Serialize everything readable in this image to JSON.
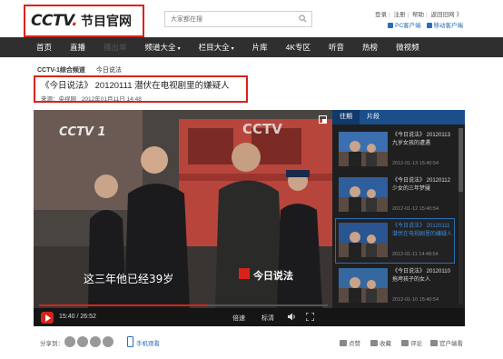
{
  "header": {
    "logo_cctv": "CCTV",
    "logo_dot": ".",
    "logo_sub": "节目官网",
    "search_placeholder": "大家都在搜",
    "top_links": [
      "登录",
      "注册",
      "帮助",
      "返回旧网"
    ],
    "top_links_arrow": "》",
    "app_links": [
      "PC客户端",
      "移动客户端"
    ]
  },
  "nav": {
    "items": [
      {
        "label": "首页",
        "dropdown": false,
        "dim": false
      },
      {
        "label": "直播",
        "dropdown": false,
        "dim": false
      },
      {
        "label": "播出单",
        "dropdown": false,
        "dim": true
      },
      {
        "label": "频道大全",
        "dropdown": true,
        "dim": false
      },
      {
        "label": "栏目大全",
        "dropdown": true,
        "dim": false
      },
      {
        "label": "片库",
        "dropdown": false,
        "dim": false
      },
      {
        "label": "4K专区",
        "dropdown": false,
        "dim": false
      },
      {
        "label": "听音",
        "dropdown": false,
        "dim": false
      },
      {
        "label": "热榜",
        "dropdown": false,
        "dim": false
      },
      {
        "label": "微视频",
        "dropdown": false,
        "dim": false
      }
    ],
    "chevron": "▾"
  },
  "breadcrumb": {
    "channel": "CCTV-1综合频道",
    "program": "今日说法"
  },
  "video": {
    "title": "《今日说法》 20120111 潜伏在电视剧里的嫌疑人",
    "source_label": "来源：",
    "source": "央视网",
    "date": "2012年01月11日 14:48",
    "watermark": "CCTV",
    "channel_badge": "CCTV 1",
    "program_logo": "今日说法",
    "subtitle": "这三年他已经39岁"
  },
  "player": {
    "current_time": "15:40",
    "total_time": "26:52",
    "progress": 0.583,
    "speed_label": "倍速",
    "quality_label": "标清"
  },
  "sidebar": {
    "tabs": [
      "往期",
      "片段"
    ],
    "items": [
      {
        "title": "《今日说法》 20120113 九岁女孩的遭遇",
        "date": "2012-01-13 15:40:54",
        "active": false
      },
      {
        "title": "《今日说法》 20120112 少女的三年梦魇",
        "date": "2012-01-12 15:40:54",
        "active": false
      },
      {
        "title": "《今日说法》 20120111 潜伏在电视剧里的嫌疑人",
        "date": "2012-01-11 14:48:54",
        "active": true
      },
      {
        "title": "《今日说法》 20120110 拖垮孩子的女人",
        "date": "2012-01-10 15:40:54",
        "active": false
      }
    ]
  },
  "share": {
    "label": "分享到：",
    "phone_label": "手机观看",
    "actions": [
      "点赞",
      "收藏",
      "评论",
      "官户端看"
    ]
  }
}
